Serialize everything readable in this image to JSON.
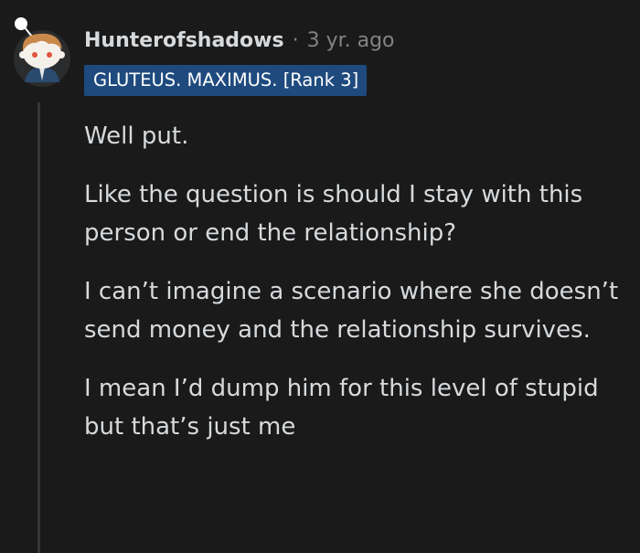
{
  "comment": {
    "author": "Hunterofshadows",
    "separator": "·",
    "timestamp": "3 yr. ago",
    "flair": "GLUTEUS. MAXIMUS. [Rank 3]",
    "paragraphs": [
      "Well put.",
      "Like the question is should I stay with this person or end the relationship?",
      "I can’t imagine a scenario where she doesn’t send money and the relationship survives.",
      "I mean I’d dump him for this level of stupid but that’s just me"
    ]
  },
  "colors": {
    "background": "#1a1a1b",
    "text": "#d7dadc",
    "meta": "#818384",
    "flair_bg": "#1e4a7e",
    "thread_line": "#343536"
  },
  "icons": {
    "avatar": "snoo-avatar-icon"
  }
}
